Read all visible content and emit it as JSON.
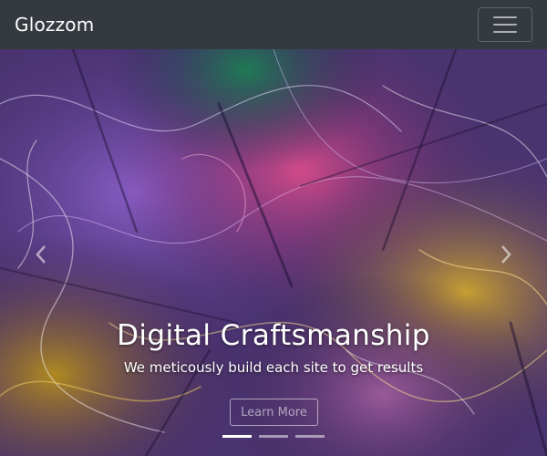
{
  "navbar": {
    "brand": "Glozzom",
    "toggler_icon": "hamburger-menu-icon",
    "background": "#343a40"
  },
  "carousel": {
    "slide": {
      "title": "Digital Craftsmanship",
      "subtitle": "We meticously build each site to get results",
      "button_label": "Learn More"
    },
    "prev_icon": "chevron-left-icon",
    "next_icon": "chevron-right-icon",
    "indicators": {
      "count": 3,
      "active_index": 0
    }
  }
}
